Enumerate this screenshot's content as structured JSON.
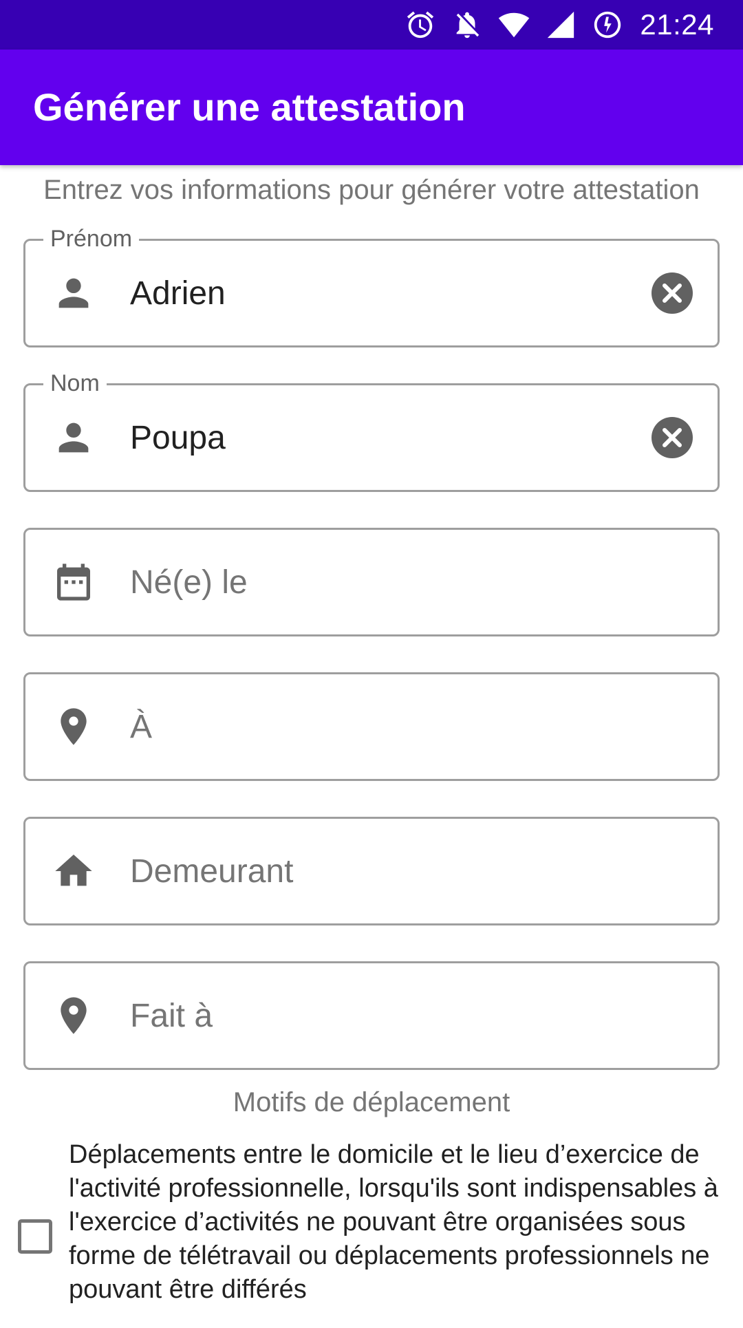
{
  "status_bar": {
    "time": "21:24",
    "icons": [
      "alarm-icon",
      "notifications-off-icon",
      "wifi-icon",
      "cell-signal-icon",
      "data-saver-icon"
    ]
  },
  "app_bar": {
    "title": "Générer une attestation"
  },
  "form": {
    "intro": "Entrez vos informations pour générer votre attestation",
    "fields": [
      {
        "label": "Prénom",
        "value": "Adrien",
        "placeholder": "",
        "icon": "person-icon",
        "clearable": true
      },
      {
        "label": "Nom",
        "value": "Poupa",
        "placeholder": "",
        "icon": "person-icon",
        "clearable": true
      },
      {
        "label": "",
        "value": "",
        "placeholder": "Né(e) le",
        "icon": "calendar-icon",
        "clearable": false
      },
      {
        "label": "",
        "value": "",
        "placeholder": "À",
        "icon": "location-pin-icon",
        "clearable": false
      },
      {
        "label": "",
        "value": "",
        "placeholder": "Demeurant",
        "icon": "home-icon",
        "clearable": false
      },
      {
        "label": "",
        "value": "",
        "placeholder": "Fait à",
        "icon": "location-pin-icon",
        "clearable": false
      }
    ]
  },
  "motifs": {
    "title": "Motifs de déplacement",
    "items": [
      {
        "text": "Déplacements entre le domicile et le lieu d’exercice de l'activité professionnelle, lorsqu'ils sont indispensables à l'exercice d’activités ne pouvant être organisées sous forme de télétravail ou déplacements professionnels ne pouvant être différés",
        "checked": false
      }
    ]
  },
  "colors": {
    "status_bar": "#3700b3",
    "app_bar": "#6200ee",
    "border": "#9e9e9e",
    "icon": "#616161"
  }
}
